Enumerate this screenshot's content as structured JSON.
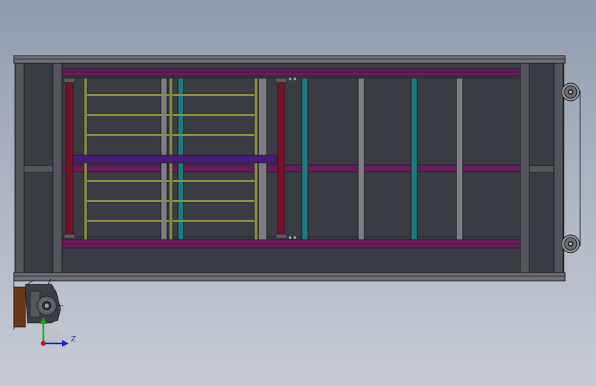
{
  "viewport": {
    "background_top": "#8f9cae",
    "background_bottom": "#c7ccd4"
  },
  "model": {
    "colors": {
      "panel": "#3a3c44",
      "frame": "#54565c",
      "frame_edge": "#1c1d22",
      "purple_bar": "#6a1a5a",
      "violet_bar": "#4a1a78",
      "crimson_bar": "#7a1028",
      "teal_bar": "#1e7a80",
      "olive_rail": "#8a8a40",
      "gray_post": "#7c7e84",
      "brown_block": "#6a3a18"
    }
  },
  "triad": {
    "z_label": "Z",
    "colors": {
      "y": "#10b010",
      "z": "#1a2ad0",
      "origin": "#d01010"
    }
  }
}
